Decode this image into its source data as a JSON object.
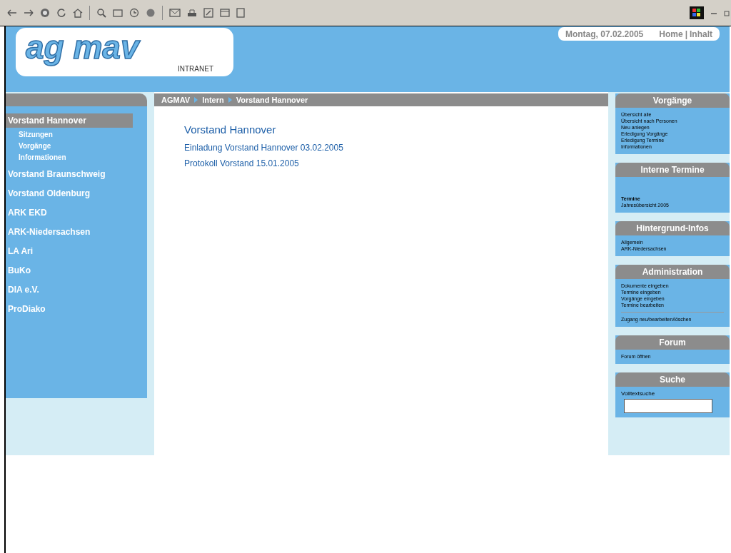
{
  "header": {
    "logo": "ag mav",
    "logo_subtitle": "INTRANET",
    "date": "Montag, 07.02.2005",
    "links": [
      {
        "label": "Home"
      },
      {
        "label": "Inhalt"
      }
    ],
    "link_separator": "|"
  },
  "breadcrumb": [
    "AGMAV",
    "Intern",
    "Vorstand Hannover"
  ],
  "sidebar": {
    "items": [
      {
        "label": "Vorstand Hannover",
        "selected": true,
        "children": [
          {
            "label": "Sitzungen"
          },
          {
            "label": "Vorgänge"
          },
          {
            "label": "Informationen"
          }
        ]
      },
      {
        "label": "Vorstand Braunschweig",
        "selected": false
      },
      {
        "label": "Vorstand Oldenburg",
        "selected": false
      },
      {
        "label": "ARK EKD",
        "selected": false
      },
      {
        "label": "ARK-Niedersachsen",
        "selected": false
      },
      {
        "label": "LA Ari",
        "selected": false
      },
      {
        "label": "BuKo",
        "selected": false
      },
      {
        "label": "DIA e.V.",
        "selected": false
      },
      {
        "label": "ProDiako",
        "selected": false
      }
    ]
  },
  "content": {
    "title": "Vorstand Hannover",
    "links": [
      "Einladung Vorstand Hannover 03.02.2005",
      "Protokoll Vorstand 15.01.2005"
    ]
  },
  "boxes": [
    {
      "title": "Vorgänge",
      "kind": "links",
      "links": [
        "Übersicht alle",
        "Übersicht nach Personen",
        "Neu anlegen",
        "Erledigung Vorgänge",
        "Erledigung Termine",
        "Informationen"
      ]
    },
    {
      "title": "Interne Termine",
      "kind": "links",
      "heading": "Termine",
      "links": [
        "Jahresübersicht 2005"
      ]
    },
    {
      "title": "Hintergrund-Infos",
      "kind": "links",
      "links": [
        "Allgemein",
        "ARK-Niedersachsen"
      ]
    },
    {
      "title": "Administration",
      "kind": "links",
      "links": [
        "Dokumente eingeben",
        "Termine eingeben",
        "Vorgänge eingeben",
        "Termine bearbeiten"
      ],
      "footer": "Zugang neu/bearbeiten/löschen"
    },
    {
      "title": "Forum",
      "kind": "links",
      "links": [
        "Forum öffnen"
      ]
    },
    {
      "title": "Suche",
      "kind": "search",
      "label": "Volltextsuche"
    }
  ]
}
